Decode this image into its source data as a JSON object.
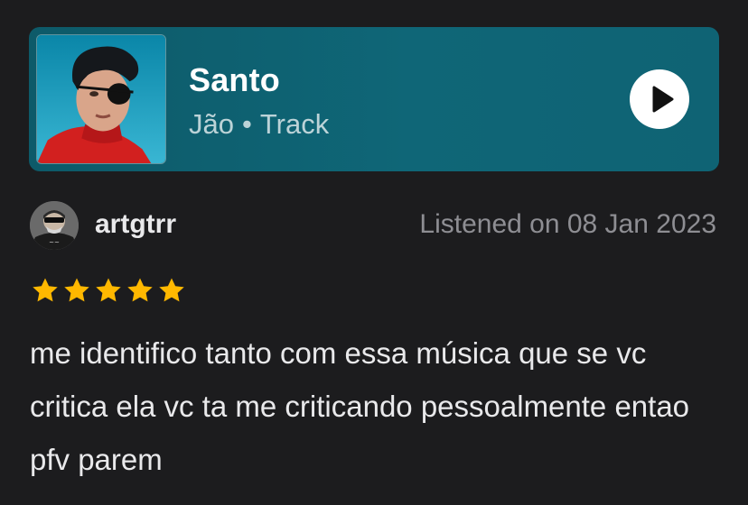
{
  "track": {
    "title": "Santo",
    "artist": "Jão",
    "separator": "•",
    "type": "Track",
    "cover_icon": "album-cover-image",
    "play_icon": "play-icon"
  },
  "review": {
    "username": "artgtrr",
    "listened": "Listened on 08 Jan 2023",
    "rating": 5,
    "rating_max": 5,
    "text": "me identifico tanto com essa música que se vc critica ela vc ta me criticando pessoalmente entao pfv parem"
  },
  "colors": {
    "background": "#1c1c1e",
    "card": "#0f6677",
    "star": "#ffb800",
    "muted": "#8e8e93"
  }
}
